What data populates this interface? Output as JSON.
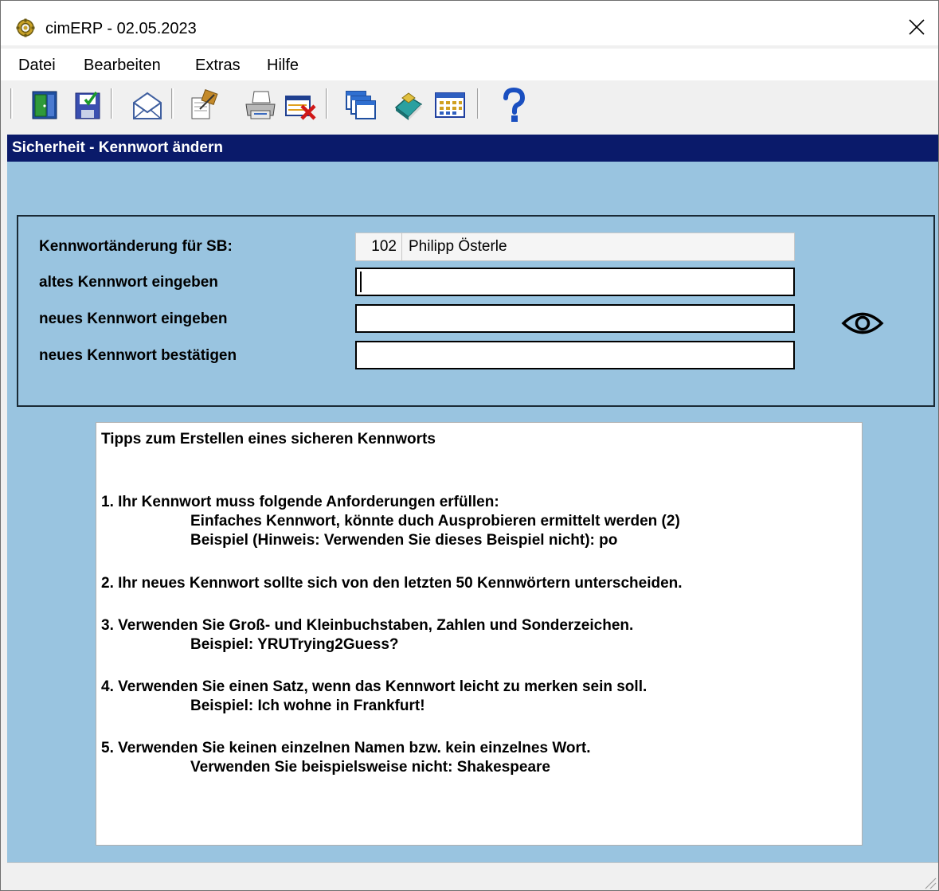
{
  "window": {
    "title": "cimERP - 02.05.2023",
    "close_glyph": "✕"
  },
  "menu": [
    "Datei",
    "Bearbeiten",
    "Extras",
    "Hilfe"
  ],
  "toolbar": {
    "buttons": [
      "exit-door-icon",
      "save-disk-icon",
      "mail-envelope-icon",
      "notepad-icon",
      "printer-icon",
      "delete-record-icon",
      "windows-icon",
      "book-icon",
      "calendar-grid-icon",
      "help-icon"
    ]
  },
  "panel": {
    "title": "Sicherheit - Kennwort ändern"
  },
  "form": {
    "sb_label": "Kennwortänderung für SB:",
    "sb_number": "102",
    "sb_name": "Philipp Österle",
    "old_label": "altes Kennwort eingeben",
    "new_label": "neues Kennwort eingeben",
    "confirm_label": "neues Kennwort bestätigen",
    "old_value": "",
    "new_value": "",
    "confirm_value": ""
  },
  "tips": {
    "heading": "Tipps zum Erstellen eines sicheren Kennworts",
    "lines": [
      "1. Ihr Kennwort muss folgende Anforderungen erfüllen:",
      "Einfaches Kennwort, könnte duch Ausprobieren ermittelt werden (2)",
      "Beispiel (Hinweis: Verwenden Sie dieses Beispiel nicht): po",
      "2. Ihr neues Kennwort sollte sich von den letzten 50 Kennwörtern unterscheiden.",
      "3. Verwenden Sie Groß- und Kleinbuchstaben, Zahlen und Sonderzeichen.",
      "Beispiel: YRUTrying2Guess?",
      "4. Verwenden Sie einen Satz, wenn das Kennwort leicht zu merken sein soll.",
      "Beispiel: Ich wohne in Frankfurt!",
      "5. Verwenden Sie keinen einzelnen Namen bzw. kein einzelnes Wort.",
      "Verwenden Sie beispielsweise nicht: Shakespeare"
    ]
  },
  "colors": {
    "panel_header": "#0a1a6a",
    "content_bg": "#99c4e0"
  }
}
